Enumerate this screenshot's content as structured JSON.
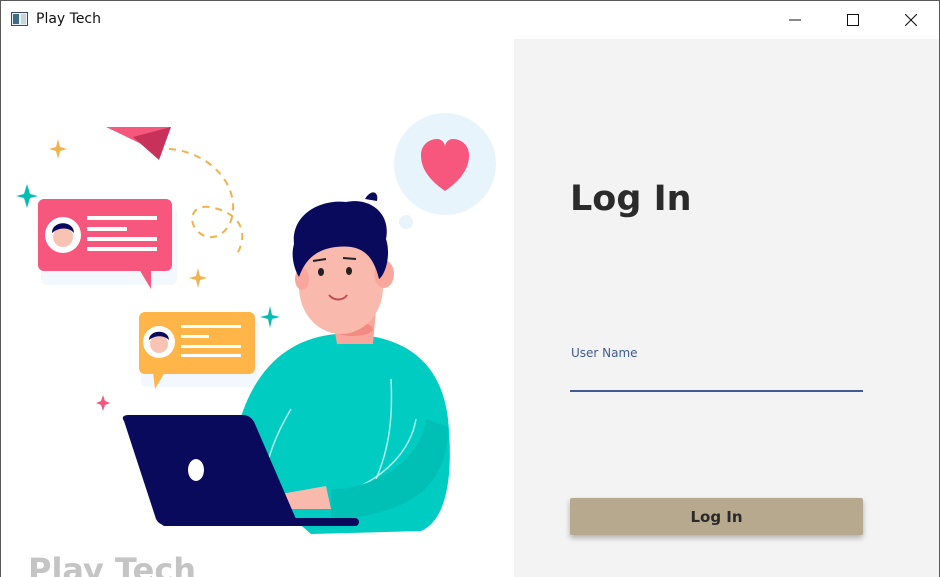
{
  "window": {
    "title": "Play Tech",
    "controls": {
      "minimize": "minimize",
      "maximize": "maximize",
      "close": "close"
    }
  },
  "left_panel": {
    "brand": "Play Tech",
    "illustration": "person-chatting-on-laptop"
  },
  "login_form": {
    "heading": "Log In",
    "username_label": "User Name",
    "username_value": "",
    "submit_label": "Log In"
  },
  "colors": {
    "accent_blue": "#3e5b93",
    "button": "#b7a98e",
    "right_panel_bg": "#f3f3f3",
    "pink": "#f7577c",
    "orange": "#ffb547",
    "teal": "#00ccc1",
    "navy": "#0a0a5c"
  }
}
